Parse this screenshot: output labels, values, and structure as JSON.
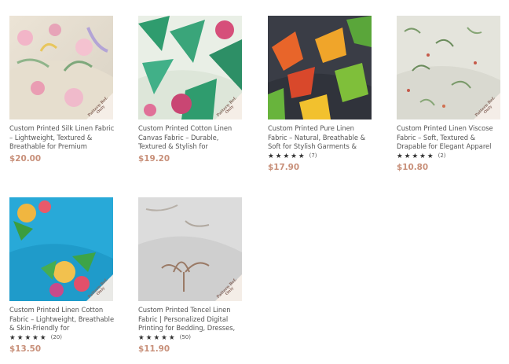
{
  "ribbon_text": "Pattern Ref. Only",
  "colors": {
    "price": "#c8907a",
    "title": "#555555",
    "star": "#333333"
  },
  "products": [
    {
      "title": "Custom Printed Silk Linen Fabric – Lightweight, Textured & Breathable for Premium",
      "price": "$20.00",
      "rating": null,
      "review_count": null
    },
    {
      "title": "Custom Printed Cotton Linen Canvas Fabric – Durable, Textured & Stylish for",
      "price": "$19.20",
      "rating": null,
      "review_count": null
    },
    {
      "title": "Custom Printed Pure Linen Fabric – Natural, Breathable & Soft for Stylish Garments &",
      "price": "$17.90",
      "rating": 5,
      "review_count": "(7)"
    },
    {
      "title": "Custom Printed Linen Viscose Fabric – Soft, Textured & Drapable for Elegant Apparel",
      "price": "$10.80",
      "rating": 5,
      "review_count": "(2)"
    },
    {
      "title": "Custom Printed Linen Cotton Fabric – Lightweight, Breathable & Skin-Friendly for",
      "price": "$13.50",
      "rating": 5,
      "review_count": "(20)"
    },
    {
      "title": "Custom Printed Tencel Linen Fabric | Personalized Digital Printing for Bedding, Dresses,",
      "price": "$11.90",
      "rating": 5,
      "review_count": "(50)"
    }
  ]
}
